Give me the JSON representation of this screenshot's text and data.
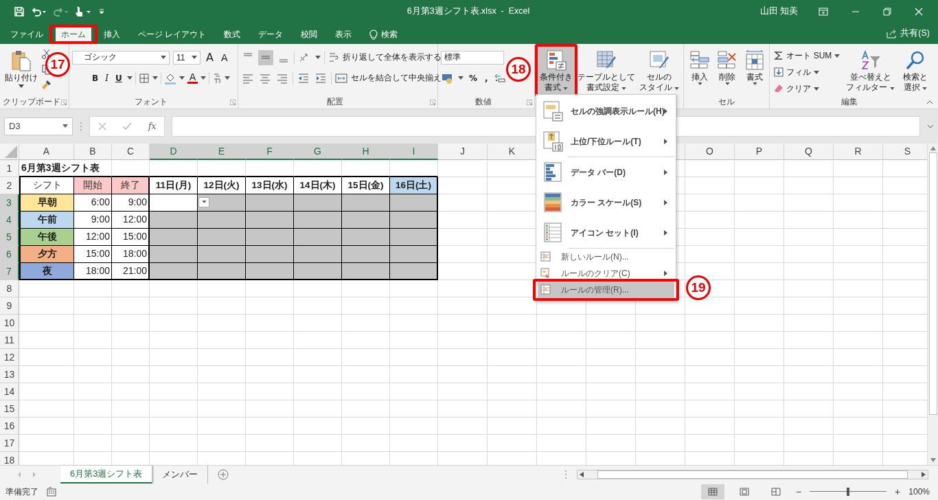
{
  "title_bar": {
    "title": "6月第3週シフト表.xlsx  -  Excel",
    "user": "山田 知美"
  },
  "menu_tabs": [
    {
      "label": "ファイル",
      "selected": false
    },
    {
      "label": "ホーム",
      "selected": true
    },
    {
      "label": "挿入",
      "selected": false
    },
    {
      "label": "ページ レイアウト",
      "selected": false
    },
    {
      "label": "数式",
      "selected": false
    },
    {
      "label": "データ",
      "selected": false
    },
    {
      "label": "校閲",
      "selected": false
    },
    {
      "label": "表示",
      "selected": false
    },
    {
      "label": "検索",
      "selected": false,
      "kind": "search"
    }
  ],
  "share": "共有(S)",
  "ribbon": {
    "clipboard": {
      "label": "クリップボード",
      "paste": "貼り付け"
    },
    "font": {
      "label": "フォント",
      "font_name": "ゴシック",
      "font_size": "11",
      "grow": "A",
      "shrink": "A",
      "bold": "B",
      "italic": "I",
      "underline": "U",
      "font_color": "A"
    },
    "alignment": {
      "label": "配置",
      "wrap_text": "折り返して全体を表示する",
      "merge": "セルを結合して中央揃え"
    },
    "number": {
      "label": "数値",
      "format": "標準",
      "percent": "%",
      "comma": ","
    },
    "styles": [
      {
        "lines": [
          "条件付き",
          "書式"
        ],
        "pressed": true
      },
      {
        "lines": [
          "テーブルとして",
          "書式設定"
        ],
        "pressed": false
      },
      {
        "lines": [
          "セルの",
          "スタイル"
        ],
        "pressed": false
      }
    ],
    "cells": {
      "label": "セル",
      "buttons": [
        "挿入",
        "削除",
        "書式"
      ]
    },
    "editing": {
      "label": "編集",
      "autosum": "オート SUM",
      "fill": "フィル",
      "clear": "クリア",
      "sort": [
        "並べ替えと",
        "フィルター"
      ],
      "find": [
        "検索と",
        "選択"
      ]
    }
  },
  "formula_bar": {
    "name_box": "D3",
    "function_label": "fx"
  },
  "sheet": {
    "columns": [
      {
        "label": "A",
        "selected": false
      },
      {
        "label": "B",
        "selected": false
      },
      {
        "label": "C",
        "selected": false
      },
      {
        "label": "D",
        "selected": true
      },
      {
        "label": "E",
        "selected": true
      },
      {
        "label": "F",
        "selected": true
      },
      {
        "label": "G",
        "selected": true
      },
      {
        "label": "H",
        "selected": true
      },
      {
        "label": "I",
        "selected": true
      },
      {
        "label": "J",
        "selected": false
      },
      {
        "label": "K",
        "selected": false
      },
      {
        "label": "O",
        "selected": false
      },
      {
        "label": "P",
        "selected": false
      },
      {
        "label": "Q",
        "selected": false
      },
      {
        "label": "R",
        "selected": false
      },
      {
        "label": "S",
        "selected": false
      }
    ],
    "rows": [
      {
        "label": "1",
        "selected": false,
        "cells": [
          {
            "text": "6月第3週シフト表",
            "kind": "title"
          }
        ]
      },
      {
        "label": "2",
        "selected": false,
        "cells": [
          {
            "text": "シフト",
            "kind": "plain"
          },
          {
            "text": "開始",
            "kind": "plain",
            "color": "#fcc8c8"
          },
          {
            "text": "終了",
            "kind": "plain",
            "color": "#fcc8c8"
          },
          {
            "text": "11日(月)",
            "kind": "bold"
          },
          {
            "text": "12日(火)",
            "kind": "bold"
          },
          {
            "text": "13日(水)",
            "kind": "bold"
          },
          {
            "text": "14日(木)",
            "kind": "bold"
          },
          {
            "text": "15日(金)",
            "kind": "bold"
          },
          {
            "text": "16日(土)",
            "kind": "bold",
            "color": "#bdd7ee"
          }
        ]
      },
      {
        "label": "3",
        "selected": true,
        "cells": [
          {
            "text": "早朝",
            "kind": "bold",
            "color": "#ffe699"
          },
          {
            "text": "6:00",
            "kind": "number"
          },
          {
            "text": "9:00",
            "kind": "number"
          }
        ]
      },
      {
        "label": "4",
        "selected": true,
        "cells": [
          {
            "text": "午前",
            "kind": "bold",
            "color": "#bdd7ee"
          },
          {
            "text": "9:00",
            "kind": "number"
          },
          {
            "text": "12:00",
            "kind": "number"
          }
        ]
      },
      {
        "label": "5",
        "selected": true,
        "cells": [
          {
            "text": "午後",
            "kind": "bold",
            "color": "#a9d08e"
          },
          {
            "text": "12:00",
            "kind": "number"
          },
          {
            "text": "15:00",
            "kind": "number"
          }
        ]
      },
      {
        "label": "6",
        "selected": true,
        "cells": [
          {
            "text": "夕方",
            "kind": "bold",
            "color": "#f4b084"
          },
          {
            "text": "15:00",
            "kind": "number"
          },
          {
            "text": "18:00",
            "kind": "number"
          }
        ]
      },
      {
        "label": "7",
        "selected": true,
        "cells": [
          {
            "text": "夜",
            "kind": "bold",
            "color": "#8ea9db"
          },
          {
            "text": "18:00",
            "kind": "number"
          },
          {
            "text": "21:00",
            "kind": "number"
          }
        ]
      },
      {
        "label": "8",
        "selected": false,
        "cells": []
      },
      {
        "label": "9",
        "selected": false,
        "cells": []
      },
      {
        "label": "10",
        "selected": false,
        "cells": []
      },
      {
        "label": "11",
        "selected": false,
        "cells": []
      },
      {
        "label": "12",
        "selected": false,
        "cells": []
      },
      {
        "label": "13",
        "selected": false,
        "cells": []
      },
      {
        "label": "14",
        "selected": false,
        "cells": []
      },
      {
        "label": "15",
        "selected": false,
        "cells": []
      },
      {
        "label": "16",
        "selected": false,
        "cells": []
      },
      {
        "label": "17",
        "selected": false,
        "cells": []
      },
      {
        "label": "18",
        "selected": false,
        "cells": []
      }
    ]
  },
  "conditional_menu": [
    {
      "label": "セルの強調表示ルール(H)",
      "kind": "large",
      "has_submenu": true,
      "selected": false
    },
    {
      "label": "上位/下位ルール(T)",
      "kind": "large",
      "has_submenu": true,
      "selected": false
    },
    {
      "label": "データ バー(D)",
      "kind": "large",
      "has_submenu": true,
      "selected": false
    },
    {
      "label": "カラー スケール(S)",
      "kind": "large",
      "has_submenu": true,
      "selected": false
    },
    {
      "label": "アイコン セット(I)",
      "kind": "large",
      "has_submenu": true,
      "selected": false
    },
    {
      "label": "新しいルール(N)...",
      "kind": "small",
      "has_submenu": false,
      "selected": false
    },
    {
      "label": "ルールのクリア(C)",
      "kind": "small",
      "has_submenu": true,
      "selected": false
    },
    {
      "label": "ルールの管理(R)...",
      "kind": "small",
      "has_submenu": false,
      "selected": true
    }
  ],
  "annotations": [
    "17",
    "18",
    "19"
  ],
  "sheet_tabs": [
    {
      "label": "6月第3週シフト表",
      "selected": true
    },
    {
      "label": "メンバー",
      "selected": false
    }
  ],
  "status_bar": {
    "status": "準備完了",
    "zoom_out": "−",
    "zoom_in": "+",
    "zoom": {
      "level": 0.5
    },
    "zoom_label": "100%"
  }
}
